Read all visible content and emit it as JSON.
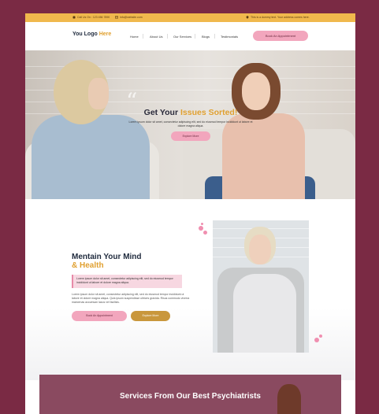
{
  "topbar": {
    "phone": "Call Us On : 123 456 7890",
    "email": "info@website.com",
    "address": "This is a dummy text. Your address comes here."
  },
  "header": {
    "logo_main": "You Logo ",
    "logo_accent": "Here",
    "nav": [
      "Home",
      "About Us",
      "Our Services",
      "Blogs",
      "Testimonials"
    ],
    "cta": "Book An Appointment"
  },
  "hero": {
    "title_prefix": "Get Your ",
    "title_highlight": "Issues Sorted!",
    "subtitle": "Lorem ipsum dolor sit amet, consectetur adipiscing elit, sed do eiusmod tempor incididunt ut labore et dolore magna aliqua.",
    "button": "Explore More"
  },
  "about": {
    "title_line1": "Mentain Your Mind",
    "title_line2": "& Health",
    "quote": "Lorem ipsum dolor sit amet, consectetur adipiscing elit, sed do eiusmod tempor incididunt ut labore et dolore magna aliqua.",
    "text": "Lorem ipsum dolor sit amet, consectetur adipiscing elit, sed do eiusmod tempor incididunt ut labore et dolore magna aliqua. Quis ipsum suspendisse ultrices gravida. Risus commodo viverra maecenas accumsan lacus vel facilisis.",
    "book_button": "Book An Appointment",
    "explore_button": "Explore More"
  },
  "services": {
    "title": "Services From Our Best Psychiatrists"
  },
  "colors": {
    "background": "#7a2a44",
    "accent_yellow": "#f0b84d",
    "accent_pink": "#f2a6bd",
    "accent_gold": "#c9973c"
  }
}
